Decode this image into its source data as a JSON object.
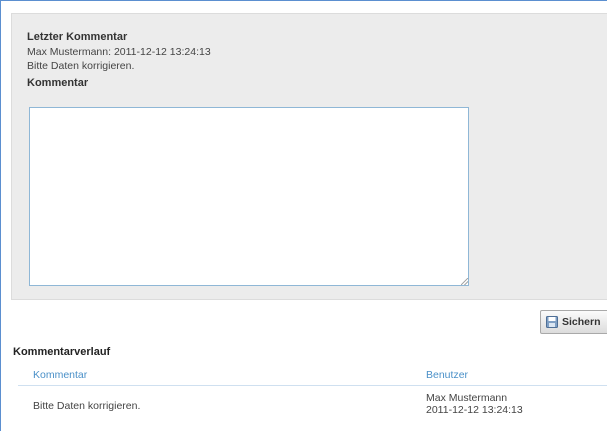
{
  "panel": {
    "last_comment_heading": "Letzter Kommentar",
    "last_comment_meta": "Max Mustermann: 2011-12-12 13:24:13",
    "last_comment_text": "Bitte Daten korrigieren.",
    "comment_field_label": "Kommentar",
    "comment_value": ""
  },
  "toolbar": {
    "save_label": "Sichern",
    "save_icon": "floppy-disk-icon"
  },
  "history": {
    "heading": "Kommentarverlauf",
    "columns": [
      "Kommentar",
      "Benutzer"
    ],
    "rows": [
      {
        "comment": "Bitte Daten korrigieren.",
        "user": "Max Mustermann",
        "timestamp": "2011-12-12 13:24:13"
      }
    ]
  },
  "colors": {
    "frame": "#5b8fd0",
    "panel_bg": "#ececec",
    "textarea_border": "#8fb7d6",
    "column_header": "#4a90c8"
  }
}
